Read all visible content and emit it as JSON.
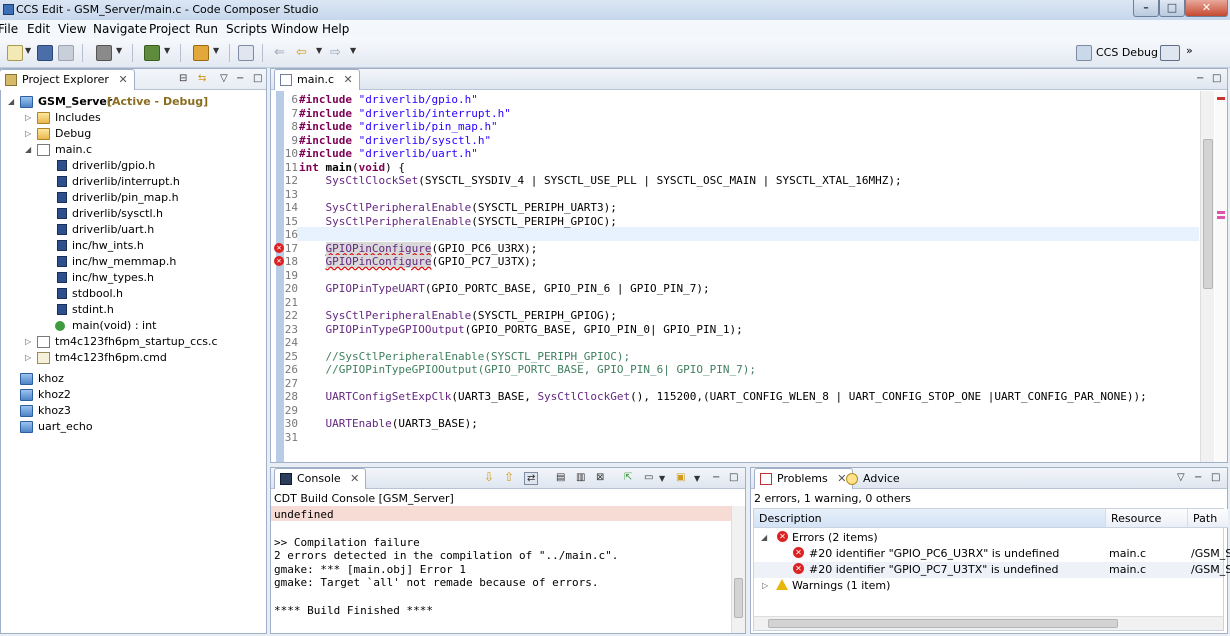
{
  "window": {
    "title": "CCS Edit - GSM_Server/main.c - Code Composer Studio"
  },
  "menu": [
    "File",
    "Edit",
    "View",
    "Navigate",
    "Project",
    "Run",
    "Scripts",
    "Window",
    "Help"
  ],
  "toolbar": {
    "perspective_label": "CCS Debug"
  },
  "project_explorer": {
    "tab_label": "Project Explorer",
    "project": {
      "name": "GSM_Server",
      "status": "[Active - Debug]"
    },
    "items": [
      {
        "label": "Includes"
      },
      {
        "label": "Debug"
      },
      {
        "label": "main.c"
      },
      {
        "label": "driverlib/gpio.h"
      },
      {
        "label": "driverlib/interrupt.h"
      },
      {
        "label": "driverlib/pin_map.h"
      },
      {
        "label": "driverlib/sysctl.h"
      },
      {
        "label": "driverlib/uart.h"
      },
      {
        "label": "inc/hw_ints.h"
      },
      {
        "label": "inc/hw_memmap.h"
      },
      {
        "label": "inc/hw_types.h"
      },
      {
        "label": "stdbool.h"
      },
      {
        "label": "stdint.h"
      },
      {
        "label": "main(void) : int"
      },
      {
        "label": "tm4c123fh6pm_startup_ccs.c"
      },
      {
        "label": "tm4c123fh6pm.cmd"
      },
      {
        "label": "khoz"
      },
      {
        "label": "khoz2"
      },
      {
        "label": "khoz3"
      },
      {
        "label": "uart_echo"
      }
    ]
  },
  "editor": {
    "tab_label": "main.c",
    "lines": [
      {
        "n": "6",
        "parts": [
          [
            "kw",
            "#include "
          ],
          [
            "st",
            "\"driverlib/gpio.h\""
          ]
        ]
      },
      {
        "n": "7",
        "parts": [
          [
            "kw",
            "#include "
          ],
          [
            "st",
            "\"driverlib/interrupt.h\""
          ]
        ]
      },
      {
        "n": "8",
        "parts": [
          [
            "kw",
            "#include "
          ],
          [
            "st",
            "\"driverlib/pin_map.h\""
          ]
        ]
      },
      {
        "n": "9",
        "parts": [
          [
            "kw",
            "#include "
          ],
          [
            "st",
            "\"driverlib/sysctl.h\""
          ]
        ]
      },
      {
        "n": "10",
        "parts": [
          [
            "kw",
            "#include "
          ],
          [
            "st",
            "\"driverlib/uart.h\""
          ]
        ]
      },
      {
        "n": "11",
        "parts": [
          [
            "kw",
            "int "
          ],
          [
            "b",
            "main"
          ],
          [
            "",
            "("
          ],
          [
            "kw",
            "void"
          ],
          [
            "",
            ") {"
          ]
        ]
      },
      {
        "n": "12",
        "parts": [
          [
            "",
            "    "
          ],
          [
            "fn",
            "SysCtlClockSet"
          ],
          [
            "",
            "(SYSCTL_SYSDIV_4 | SYSCTL_USE_PLL | SYSCTL_OSC_MAIN | SYSCTL_XTAL_16MHZ);"
          ]
        ]
      },
      {
        "n": "13",
        "parts": []
      },
      {
        "n": "14",
        "parts": [
          [
            "",
            "    "
          ],
          [
            "fn",
            "SysCtlPeripheralEnable"
          ],
          [
            "",
            "(SYSCTL_PERIPH_UART3);"
          ]
        ]
      },
      {
        "n": "15",
        "parts": [
          [
            "",
            "    "
          ],
          [
            "fn",
            "SysCtlPeripheralEnable"
          ],
          [
            "",
            "(SYSCTL_PERIPH_GPIOC);"
          ]
        ]
      },
      {
        "n": "16",
        "parts": []
      },
      {
        "n": "17",
        "err": true,
        "parts": [
          [
            "",
            "    "
          ],
          [
            "fnerr",
            "GPIOPinConfigure"
          ],
          [
            "",
            "(GPIO_PC6_U3RX);"
          ]
        ]
      },
      {
        "n": "18",
        "err": true,
        "parts": [
          [
            "",
            "    "
          ],
          [
            "fnerr",
            "GPIOPinConfigure"
          ],
          [
            "",
            "(GPIO_PC7_U3TX);"
          ]
        ]
      },
      {
        "n": "19",
        "parts": []
      },
      {
        "n": "20",
        "parts": [
          [
            "",
            "    "
          ],
          [
            "fn",
            "GPIOPinTypeUART"
          ],
          [
            "",
            "(GPIO_PORTC_BASE, GPIO_PIN_6 | GPIO_PIN_7);"
          ]
        ]
      },
      {
        "n": "21",
        "parts": []
      },
      {
        "n": "22",
        "parts": [
          [
            "",
            "    "
          ],
          [
            "fn",
            "SysCtlPeripheralEnable"
          ],
          [
            "",
            "(SYSCTL_PERIPH_GPIOG);"
          ]
        ]
      },
      {
        "n": "23",
        "parts": [
          [
            "",
            "    "
          ],
          [
            "fn",
            "GPIOPinTypeGPIOOutput"
          ],
          [
            "",
            "(GPIO_PORTG_BASE, GPIO_PIN_0| GPIO_PIN_1);"
          ]
        ]
      },
      {
        "n": "24",
        "parts": []
      },
      {
        "n": "25",
        "parts": [
          [
            "cm",
            "    //SysCtlPeripheralEnable(SYSCTL_PERIPH_GPIOC);"
          ]
        ]
      },
      {
        "n": "26",
        "parts": [
          [
            "cm",
            "    //GPIOPinTypeGPIOOutput(GPIO_PORTC_BASE, GPIO_PIN_6| GPIO_PIN_7);"
          ]
        ]
      },
      {
        "n": "27",
        "parts": []
      },
      {
        "n": "28",
        "parts": [
          [
            "",
            "    "
          ],
          [
            "fn",
            "UARTConfigSetExpClk"
          ],
          [
            "",
            "(UART3_BASE, "
          ],
          [
            "fn",
            "SysCtlClockGet"
          ],
          [
            "",
            "(), 115200,(UART_CONFIG_WLEN_8 | UART_CONFIG_STOP_ONE |UART_CONFIG_PAR_NONE));"
          ]
        ]
      },
      {
        "n": "29",
        "parts": []
      },
      {
        "n": "30",
        "parts": [
          [
            "",
            "    "
          ],
          [
            "fn",
            "UARTEnable"
          ],
          [
            "",
            "(UART3_BASE);"
          ]
        ]
      },
      {
        "n": "31",
        "parts": []
      }
    ]
  },
  "console": {
    "tab_label": "Console",
    "header": "CDT Build Console [GSM_Server]",
    "lines": [
      "undefined",
      "",
      ">> Compilation failure",
      "2 errors detected in the compilation of \"../main.c\".",
      "gmake: *** [main.obj] Error 1",
      "gmake: Target `all' not remade because of errors.",
      "",
      "**** Build Finished ****"
    ]
  },
  "problems": {
    "tab_label": "Problems",
    "advice_tab_label": "Advice",
    "summary": "2 errors, 1 warning, 0 others",
    "columns": {
      "description": "Description",
      "resource": "Resource",
      "path": "Path"
    },
    "errors_group": "Errors (2 items)",
    "errors": [
      {
        "description": "#20 identifier \"GPIO_PC6_U3RX\" is undefined",
        "resource": "main.c",
        "path": "/GSM_S"
      },
      {
        "description": "#20 identifier \"GPIO_PC7_U3TX\" is undefined",
        "resource": "main.c",
        "path": "/GSM_S"
      }
    ],
    "warnings_group": "Warnings (1 item)"
  },
  "colors": {
    "error": "#dd2222",
    "keyword": "#7f0055",
    "string": "#2a00ff",
    "comment": "#3f7f5f"
  }
}
